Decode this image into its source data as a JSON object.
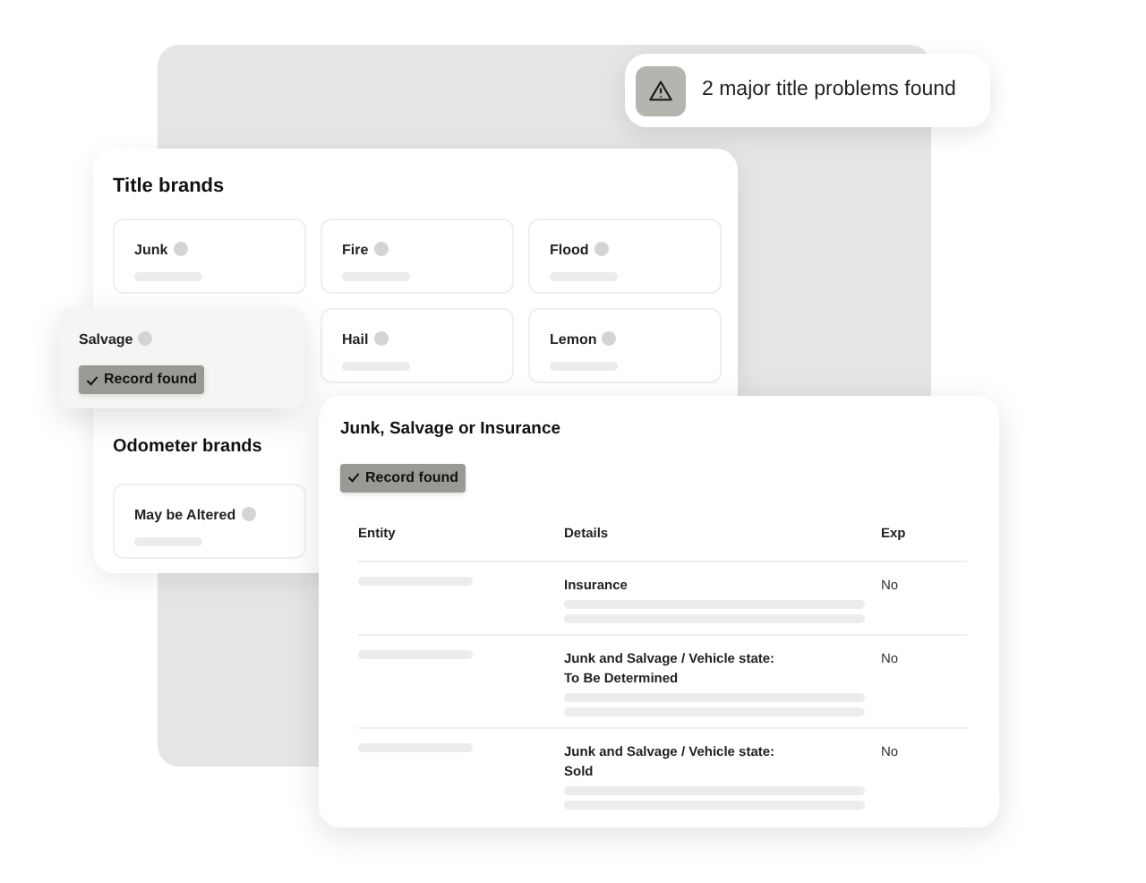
{
  "alert": {
    "text": "2 major title problems found"
  },
  "title_brands": {
    "title": "Title brands",
    "items": [
      {
        "label": "Junk",
        "record_found": false
      },
      {
        "label": "Fire",
        "record_found": false
      },
      {
        "label": "Flood",
        "record_found": false
      },
      {
        "label": "Salvage",
        "record_found": true,
        "badge": "Record found"
      },
      {
        "label": "Hail",
        "record_found": false
      },
      {
        "label": "Lemon",
        "record_found": false
      }
    ]
  },
  "odometer_brands": {
    "title": "Odometer brands",
    "items": [
      {
        "label": "May be Altered",
        "record_found": false
      }
    ]
  },
  "detail": {
    "title": "Junk, Salvage or Insurance",
    "badge": "Record found",
    "columns": [
      "Entity",
      "Details",
      "Exp"
    ],
    "rows": [
      {
        "details": [
          "Insurance"
        ],
        "exp": "No"
      },
      {
        "details": [
          "Junk and Salvage / Vehicle state:",
          "To Be Determined"
        ],
        "exp": "No"
      },
      {
        "details": [
          "Junk and Salvage / Vehicle state:",
          "Sold"
        ],
        "exp": "No"
      }
    ]
  }
}
